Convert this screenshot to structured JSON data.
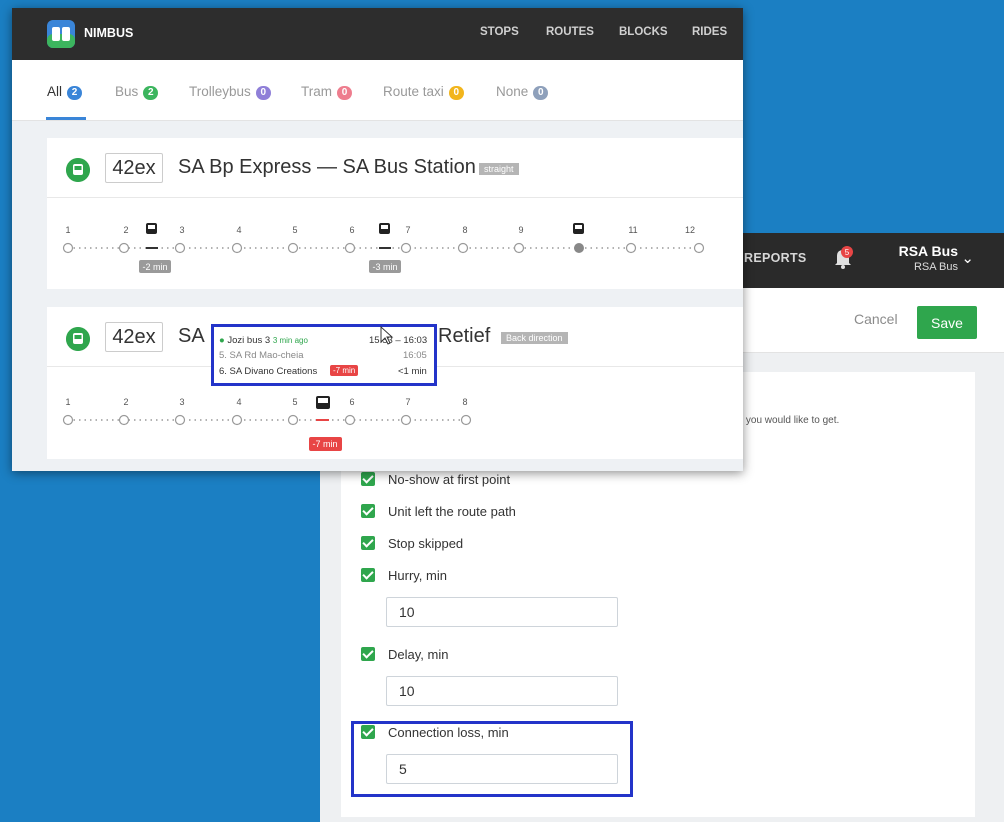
{
  "back_window": {
    "nav_reports": "REPORTS",
    "notification_count": "5",
    "user_name": "RSA Bus",
    "user_sub": "RSA Bus",
    "cancel_label": "Cancel",
    "save_label": "Save",
    "hint_text": "ons you would like to get.",
    "options": [
      {
        "label": "No-show at first point",
        "checked": true
      },
      {
        "label": "Unit left the route path",
        "checked": true
      },
      {
        "label": "Stop skipped",
        "checked": true
      },
      {
        "label": "Hurry, min",
        "checked": true,
        "value": "10"
      },
      {
        "label": "Delay, min",
        "checked": true,
        "value": "10"
      },
      {
        "label": "Connection loss, min",
        "checked": true,
        "value": "5"
      }
    ]
  },
  "front_window": {
    "brand": "NIMBUS",
    "nav": [
      "STOPS",
      "ROUTES",
      "BLOCKS",
      "RIDES"
    ],
    "filters": [
      {
        "label": "All",
        "count": "2",
        "color": "#3a85d8"
      },
      {
        "label": "Bus",
        "count": "2",
        "color": "#3cb55e"
      },
      {
        "label": "Trolleybus",
        "count": "0",
        "color": "#8f7fd8"
      },
      {
        "label": "Tram",
        "count": "0",
        "color": "#ee7d8e"
      },
      {
        "label": "Route taxi",
        "count": "0",
        "color": "#f2b51c"
      },
      {
        "label": "None",
        "count": "0",
        "color": "#8ea0bb"
      }
    ],
    "routes": [
      {
        "number": "42ex",
        "title": "SA Bp Express — SA Bus Station",
        "tag": "straight",
        "stops": [
          "1",
          "2",
          "3",
          "4",
          "5",
          "6",
          "7",
          "8",
          "9",
          "11",
          "12"
        ],
        "delays": [
          "-2 min",
          "-3 min"
        ]
      },
      {
        "number": "42ex",
        "title_left": "SA",
        "title_right": "Retief",
        "tag": "Back direction",
        "stops": [
          "1",
          "2",
          "3",
          "4",
          "5",
          "6",
          "7",
          "8"
        ],
        "delays": [
          "-7 min"
        ]
      }
    ],
    "tooltip": {
      "unit": "Jozi bus 3",
      "ago": "3 min ago",
      "time_range": "15:53 – 16:03",
      "stop5": "5. SA Rd Mao-cheia",
      "stop5_time": "16:05",
      "stop6": "6. SA Divano Creations",
      "stop6_delay": "-7 min",
      "stop6_eta": "<1 min"
    }
  },
  "colors": {
    "accent_green": "#2fa64d",
    "highlight_blue": "#2334c9",
    "delay_red": "#e84545"
  }
}
